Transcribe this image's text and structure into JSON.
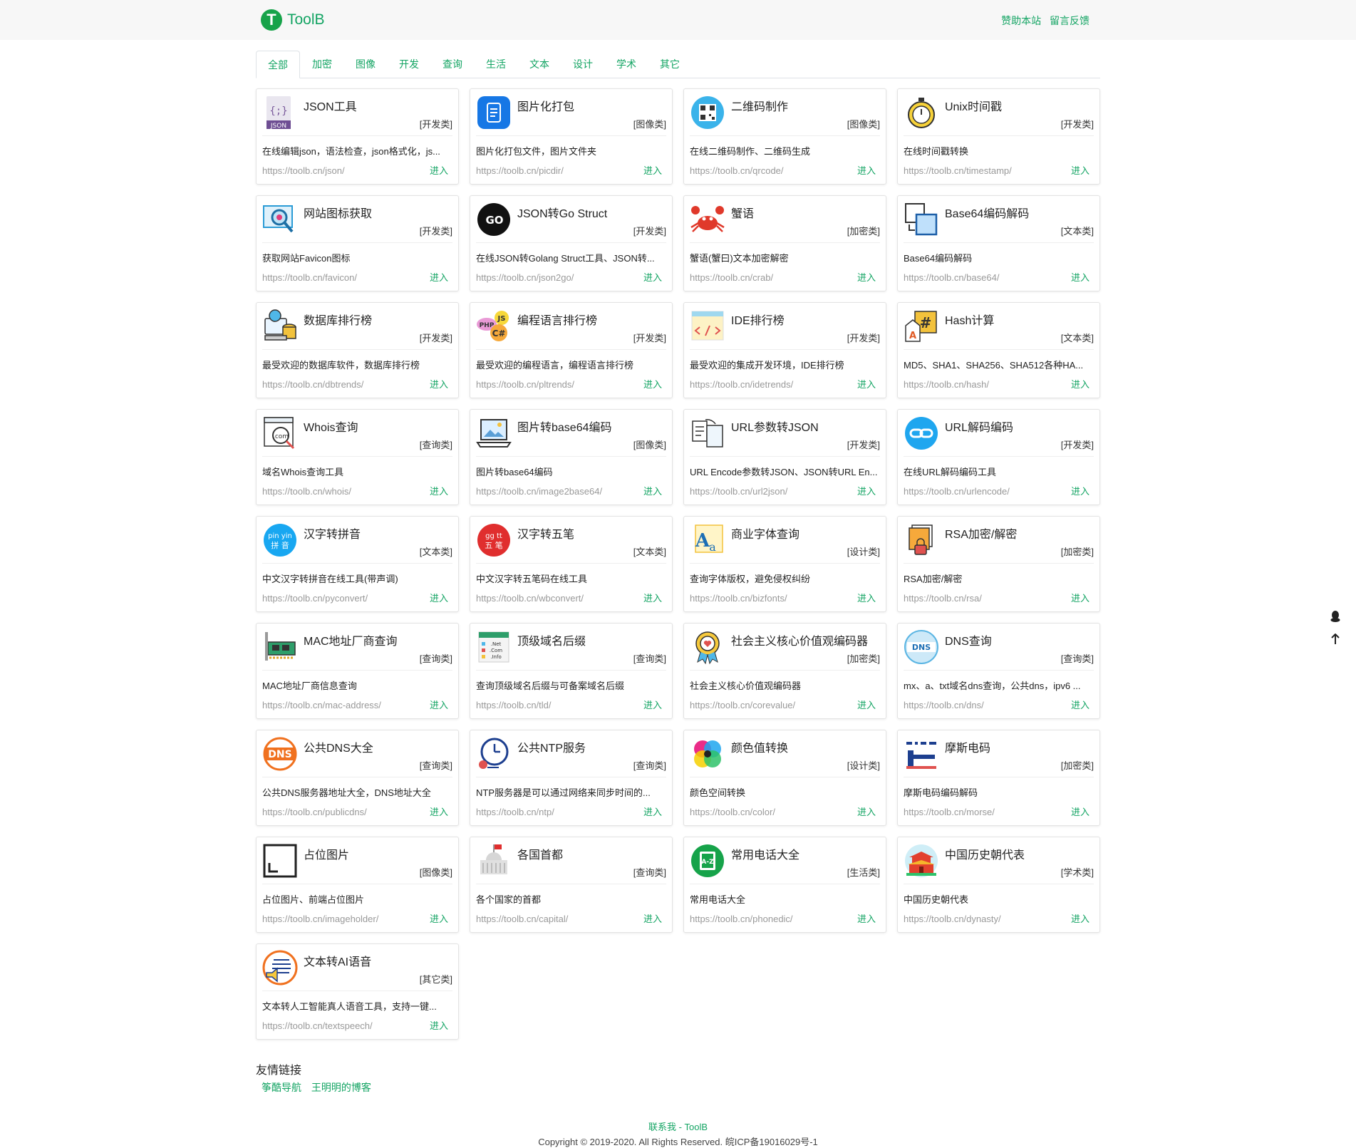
{
  "header": {
    "logo_letter": "T",
    "logo_text": "ToolB",
    "links": [
      "赞助本站",
      "留言反馈"
    ]
  },
  "tabs": [
    "全部",
    "加密",
    "图像",
    "开发",
    "查询",
    "生活",
    "文本",
    "设计",
    "学术",
    "其它"
  ],
  "enter_label": "进入",
  "tools": [
    {
      "title": "JSON工具",
      "category": "[开发类]",
      "desc": "在线编辑json，语法检查，json格式化，js...",
      "url": "https://toolb.cn/json/",
      "icon": "json-icon"
    },
    {
      "title": "图片化打包",
      "category": "[图像类]",
      "desc": "图片化打包文件，图片文件夹",
      "url": "https://toolb.cn/picdir/",
      "icon": "document-icon"
    },
    {
      "title": "二维码制作",
      "category": "[图像类]",
      "desc": "在线二维码制作、二维码生成",
      "url": "https://toolb.cn/qrcode/",
      "icon": "qrcode-icon"
    },
    {
      "title": "Unix时间戳",
      "category": "[开发类]",
      "desc": "在线时间戳转换",
      "url": "https://toolb.cn/timestamp/",
      "icon": "stopwatch-icon"
    },
    {
      "title": "网站图标获取",
      "category": "[开发类]",
      "desc": "获取网站Favicon图标",
      "url": "https://toolb.cn/favicon/",
      "icon": "search-web-icon"
    },
    {
      "title": "JSON转Go Struct",
      "category": "[开发类]",
      "desc": "在线JSON转Golang Struct工具、JSON转...",
      "url": "https://toolb.cn/json2go/",
      "icon": "go-icon"
    },
    {
      "title": "蟹语",
      "category": "[加密类]",
      "desc": "蟹语(蟹曰)文本加密解密",
      "url": "https://toolb.cn/crab/",
      "icon": "crab-icon"
    },
    {
      "title": "Base64编码解码",
      "category": "[文本类]",
      "desc": "Base64编码解码",
      "url": "https://toolb.cn/base64/",
      "icon": "convert-icon"
    },
    {
      "title": "数据库排行榜",
      "category": "[开发类]",
      "desc": "最受欢迎的数据库软件，数据库排行榜",
      "url": "https://toolb.cn/dbtrends/",
      "icon": "database-icon"
    },
    {
      "title": "编程语言排行榜",
      "category": "[开发类]",
      "desc": "最受欢迎的编程语言，编程语言排行榜",
      "url": "https://toolb.cn/pltrends/",
      "icon": "languages-icon"
    },
    {
      "title": "IDE排行榜",
      "category": "[开发类]",
      "desc": "最受欢迎的集成开发环境，IDE排行榜",
      "url": "https://toolb.cn/idetrends/",
      "icon": "code-window-icon"
    },
    {
      "title": "Hash计算",
      "category": "[文本类]",
      "desc": "MD5、SHA1、SHA256、SHA512各种HA...",
      "url": "https://toolb.cn/hash/",
      "icon": "hash-icon"
    },
    {
      "title": "Whois查询",
      "category": "[查询类]",
      "desc": "域名Whois查询工具",
      "url": "https://toolb.cn/whois/",
      "icon": "domain-search-icon"
    },
    {
      "title": "图片转base64编码",
      "category": "[图像类]",
      "desc": "图片转base64编码",
      "url": "https://toolb.cn/image2base64/",
      "icon": "laptop-image-icon"
    },
    {
      "title": "URL参数转JSON",
      "category": "[开发类]",
      "desc": "URL Encode参数转JSON、JSON转URL En...",
      "url": "https://toolb.cn/url2json/",
      "icon": "file-sync-icon"
    },
    {
      "title": "URL解码编码",
      "category": "[开发类]",
      "desc": "在线URL解码编码工具",
      "url": "https://toolb.cn/urlencode/",
      "icon": "link-icon"
    },
    {
      "title": "汉字转拼音",
      "category": "[文本类]",
      "desc": "中文汉字转拼音在线工具(带声调)",
      "url": "https://toolb.cn/pyconvert/",
      "icon": "pinyin-icon"
    },
    {
      "title": "汉字转五笔",
      "category": "[文本类]",
      "desc": "中文汉字转五笔码在线工具",
      "url": "https://toolb.cn/wbconvert/",
      "icon": "wubi-icon"
    },
    {
      "title": "商业字体查询",
      "category": "[设计类]",
      "desc": "查询字体版权，避免侵权纠纷",
      "url": "https://toolb.cn/bizfonts/",
      "icon": "font-icon"
    },
    {
      "title": "RSA加密/解密",
      "category": "[加密类]",
      "desc": "RSA加密/解密",
      "url": "https://toolb.cn/rsa/",
      "icon": "lock-document-icon"
    },
    {
      "title": "MAC地址厂商查询",
      "category": "[查询类]",
      "desc": "MAC地址厂商信息查询",
      "url": "https://toolb.cn/mac-address/",
      "icon": "network-card-icon"
    },
    {
      "title": "顶级域名后缀",
      "category": "[查询类]",
      "desc": "查询顶级域名后缀与可备案域名后缀",
      "url": "https://toolb.cn/tld/",
      "icon": "domain-list-icon"
    },
    {
      "title": "社会主义核心价值观编码器",
      "category": "[加密类]",
      "desc": "社会主义核心价值观编码器",
      "url": "https://toolb.cn/corevalue/",
      "icon": "badge-icon"
    },
    {
      "title": "DNS查询",
      "category": "[查询类]",
      "desc": "mx、a、txt域名dns查询，公共dns，ipv6 ...",
      "url": "https://toolb.cn/dns/",
      "icon": "dns-globe-icon"
    },
    {
      "title": "公共DNS大全",
      "category": "[查询类]",
      "desc": "公共DNS服务器地址大全，DNS地址大全",
      "url": "https://toolb.cn/publicdns/",
      "icon": "dns-icon"
    },
    {
      "title": "公共NTP服务",
      "category": "[查询类]",
      "desc": "NTP服务器是可以通过网络来同步时间的...",
      "url": "https://toolb.cn/ntp/",
      "icon": "clock-icon"
    },
    {
      "title": "颜色值转换",
      "category": "[设计类]",
      "desc": "颜色空间转换",
      "url": "https://toolb.cn/color/",
      "icon": "color-wheel-icon"
    },
    {
      "title": "摩斯电码",
      "category": "[加密类]",
      "desc": "摩斯电码编码解码",
      "url": "https://toolb.cn/morse/",
      "icon": "telegraph-icon"
    },
    {
      "title": "占位图片",
      "category": "[图像类]",
      "desc": "占位图片、前端占位图片",
      "url": "https://toolb.cn/imageholder/",
      "icon": "placeholder-frame-icon"
    },
    {
      "title": "各国首都",
      "category": "[查询类]",
      "desc": "各个国家的首都",
      "url": "https://toolb.cn/capital/",
      "icon": "capitol-icon"
    },
    {
      "title": "常用电话大全",
      "category": "[生活类]",
      "desc": "常用电话大全",
      "url": "https://toolb.cn/phonedic/",
      "icon": "phonebook-icon"
    },
    {
      "title": "中国历史朝代表",
      "category": "[学术类]",
      "desc": "中国历史朝代表",
      "url": "https://toolb.cn/dynasty/",
      "icon": "palace-icon"
    },
    {
      "title": "文本转AI语音",
      "category": "[其它类]",
      "desc": "文本转人工智能真人语音工具，支持一键...",
      "url": "https://toolb.cn/textspeech/",
      "icon": "speech-icon"
    }
  ],
  "friends": {
    "title": "友情链接",
    "links": [
      "筝酷导航",
      "王明明的博客"
    ]
  },
  "footer": {
    "contact": "联系我",
    "separator": " - ",
    "site": "ToolB",
    "copyright": "Copyright © 2019-2020. All Rights Reserved. ",
    "icp": "皖ICP备19016029号-1"
  }
}
